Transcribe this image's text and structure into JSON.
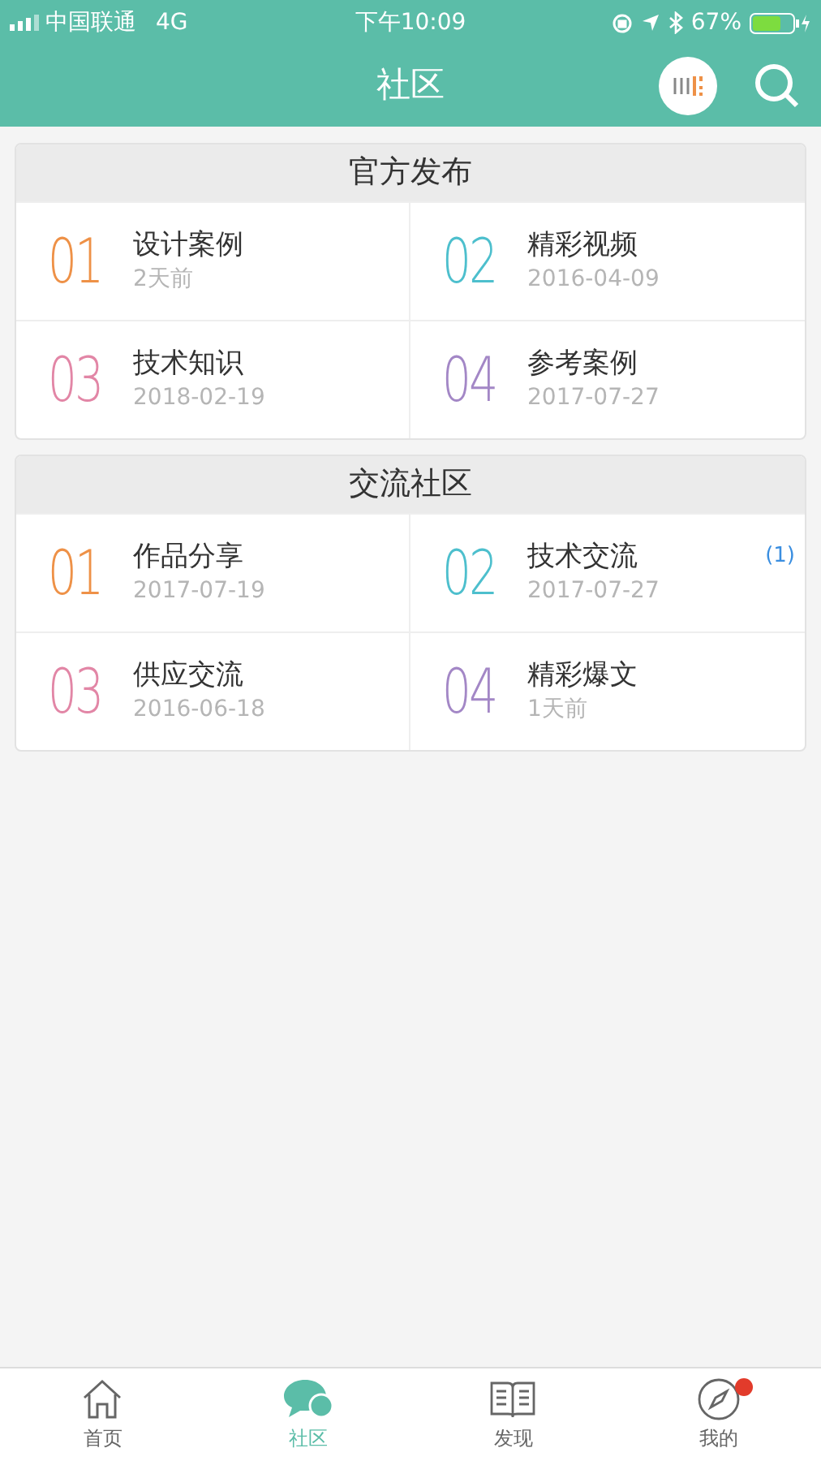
{
  "status_bar": {
    "carrier": "中国联通",
    "network": "4G",
    "time": "下午10:09",
    "battery": "67%"
  },
  "header": {
    "title": "社区"
  },
  "sections": [
    {
      "title": "官方发布",
      "items": [
        {
          "number": "01",
          "color": "#ee9147",
          "title": "设计案例",
          "date": "2天前"
        },
        {
          "number": "02",
          "color": "#4dbfcd",
          "title": "精彩视频",
          "date": "2016-04-09"
        },
        {
          "number": "03",
          "color": "#e286a6",
          "title": "技术知识",
          "date": "2018-02-19"
        },
        {
          "number": "04",
          "color": "#a387c6",
          "title": "参考案例",
          "date": "2017-07-27"
        }
      ]
    },
    {
      "title": "交流社区",
      "items": [
        {
          "number": "01",
          "color": "#ee9147",
          "title": "作品分享",
          "date": "2017-07-19"
        },
        {
          "number": "02",
          "color": "#4dbfcd",
          "title": "技术交流",
          "date": "2017-07-27",
          "badge": "(1)"
        },
        {
          "number": "03",
          "color": "#e286a6",
          "title": "供应交流",
          "date": "2016-06-18"
        },
        {
          "number": "04",
          "color": "#a387c6",
          "title": "精彩爆文",
          "date": "1天前"
        }
      ]
    }
  ],
  "tab_bar": [
    {
      "kind": "home",
      "label": "首页",
      "selected": false,
      "dot": false
    },
    {
      "kind": "chat",
      "label": "社区",
      "selected": true,
      "dot": false
    },
    {
      "kind": "book",
      "label": "发现",
      "selected": false,
      "dot": false
    },
    {
      "kind": "compass",
      "label": "我的",
      "selected": false,
      "dot": true
    }
  ]
}
